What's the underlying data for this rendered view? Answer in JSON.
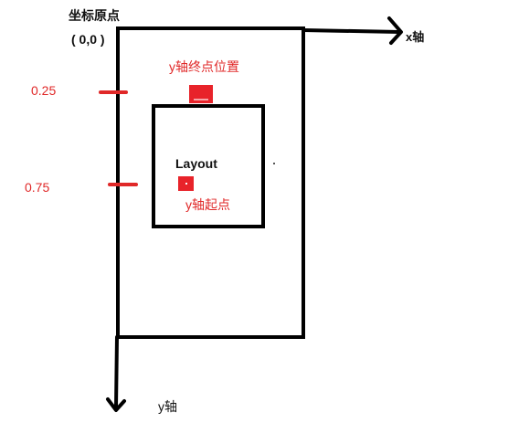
{
  "colors": {
    "stroke": "#000000",
    "accent": "#e02828",
    "text": "#111111"
  },
  "labels": {
    "origin_title": "坐标原点",
    "origin_coords": "( 0,0 )",
    "x_axis": "x轴",
    "y_axis": "y轴",
    "y_end": "y轴终点位置",
    "y_start": "y轴起点",
    "layout": "Layout",
    "mark_top": "0.25",
    "mark_bottom": "0.75"
  }
}
